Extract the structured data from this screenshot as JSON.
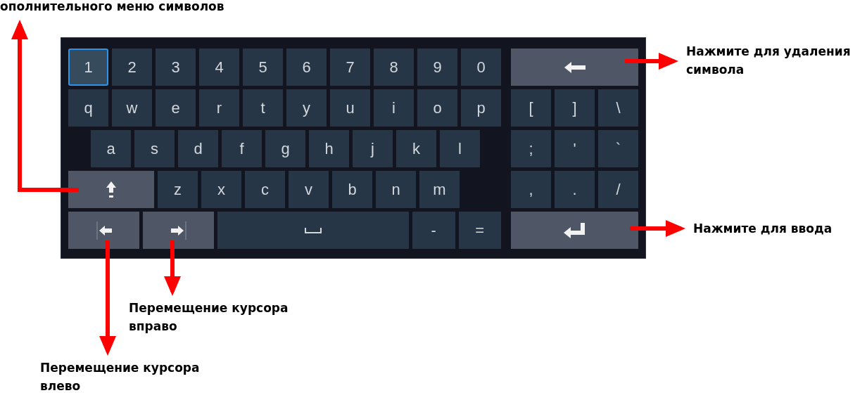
{
  "keyboard": {
    "main_rows": [
      [
        {
          "kind": "char",
          "label": "1",
          "selected": true
        },
        {
          "kind": "char",
          "label": "2",
          "selected": false
        },
        {
          "kind": "char",
          "label": "3",
          "selected": false
        },
        {
          "kind": "char",
          "label": "4",
          "selected": false
        },
        {
          "kind": "char",
          "label": "5",
          "selected": false
        },
        {
          "kind": "char",
          "label": "6",
          "selected": false
        },
        {
          "kind": "char",
          "label": "7",
          "selected": false
        },
        {
          "kind": "char",
          "label": "8",
          "selected": false
        },
        {
          "kind": "char",
          "label": "9",
          "selected": false
        },
        {
          "kind": "char",
          "label": "0",
          "selected": false
        }
      ],
      [
        {
          "kind": "char",
          "label": "q",
          "selected": false
        },
        {
          "kind": "char",
          "label": "w",
          "selected": false
        },
        {
          "kind": "char",
          "label": "e",
          "selected": false
        },
        {
          "kind": "char",
          "label": "r",
          "selected": false
        },
        {
          "kind": "char",
          "label": "t",
          "selected": false
        },
        {
          "kind": "char",
          "label": "y",
          "selected": false
        },
        {
          "kind": "char",
          "label": "u",
          "selected": false
        },
        {
          "kind": "char",
          "label": "i",
          "selected": false
        },
        {
          "kind": "char",
          "label": "o",
          "selected": false
        },
        {
          "kind": "char",
          "label": "p",
          "selected": false
        }
      ],
      [
        {
          "kind": "char",
          "label": "a",
          "selected": false
        },
        {
          "kind": "char",
          "label": "s",
          "selected": false
        },
        {
          "kind": "char",
          "label": "d",
          "selected": false
        },
        {
          "kind": "char",
          "label": "f",
          "selected": false
        },
        {
          "kind": "char",
          "label": "g",
          "selected": false
        },
        {
          "kind": "char",
          "label": "h",
          "selected": false
        },
        {
          "kind": "char",
          "label": "j",
          "selected": false
        },
        {
          "kind": "char",
          "label": "k",
          "selected": false
        },
        {
          "kind": "char",
          "label": "l",
          "selected": false
        }
      ],
      [
        {
          "kind": "shift",
          "selected": false
        },
        {
          "kind": "char",
          "label": "z",
          "selected": false
        },
        {
          "kind": "char",
          "label": "x",
          "selected": false
        },
        {
          "kind": "char",
          "label": "c",
          "selected": false
        },
        {
          "kind": "char",
          "label": "v",
          "selected": false
        },
        {
          "kind": "char",
          "label": "b",
          "selected": false
        },
        {
          "kind": "char",
          "label": "n",
          "selected": false
        },
        {
          "kind": "char",
          "label": "m",
          "selected": false
        }
      ],
      [
        {
          "kind": "left",
          "selected": false
        },
        {
          "kind": "right",
          "selected": false
        },
        {
          "kind": "space",
          "selected": false
        },
        {
          "kind": "char",
          "label": "-",
          "selected": false
        },
        {
          "kind": "char",
          "label": "=",
          "selected": false
        }
      ]
    ],
    "side_rows": [
      [
        {
          "kind": "backspace",
          "selected": false
        }
      ],
      [
        {
          "kind": "char",
          "label": "[",
          "selected": false
        },
        {
          "kind": "char",
          "label": "]",
          "selected": false
        },
        {
          "kind": "char",
          "label": "\\",
          "selected": false
        }
      ],
      [
        {
          "kind": "char",
          "label": ";",
          "selected": false
        },
        {
          "kind": "char",
          "label": "'",
          "selected": false
        },
        {
          "kind": "char",
          "label": "`",
          "selected": false
        }
      ],
      [
        {
          "kind": "char",
          "label": ",",
          "selected": false
        },
        {
          "kind": "char",
          "label": ".",
          "selected": false
        },
        {
          "kind": "char",
          "label": "/",
          "selected": false
        }
      ],
      [
        {
          "kind": "enter",
          "selected": false
        }
      ]
    ]
  },
  "annotations": [
    {
      "text": "ополнительного меню символов"
    },
    {
      "text": "Нажмите для удаления\nсимвола"
    },
    {
      "text": "Нажмите для ввода"
    },
    {
      "text": "Перемещение курсора\nвправо"
    },
    {
      "text": "Перемещение курсора\nвлево"
    }
  ]
}
